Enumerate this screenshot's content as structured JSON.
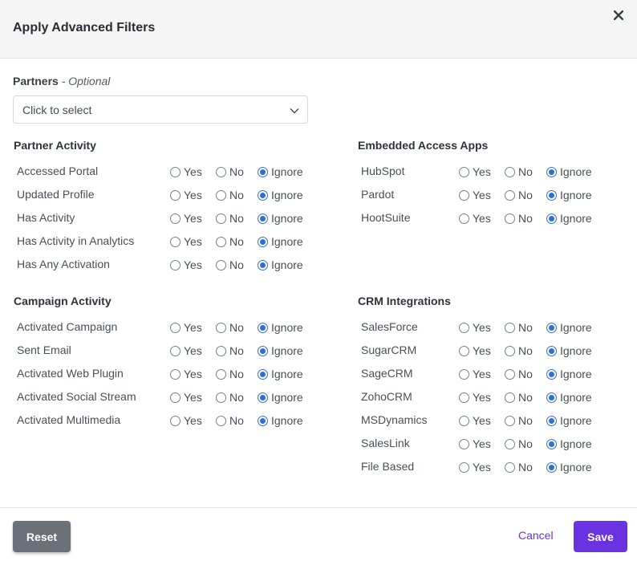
{
  "dialog": {
    "title": "Apply Advanced Filters"
  },
  "partners": {
    "label": "Partners",
    "optional": "- Optional",
    "placeholder": "Click to select"
  },
  "options": {
    "yes": "Yes",
    "no": "No",
    "ignore": "Ignore"
  },
  "sections": {
    "partner_activity": {
      "title": "Partner Activity",
      "rows": [
        {
          "label": "Accessed Portal",
          "selected": "ignore"
        },
        {
          "label": "Updated Profile",
          "selected": "ignore"
        },
        {
          "label": "Has Activity",
          "selected": "ignore"
        },
        {
          "label": "Has Activity in Analytics",
          "selected": "ignore"
        },
        {
          "label": "Has Any Activation",
          "selected": "ignore"
        }
      ]
    },
    "embedded_access_apps": {
      "title": "Embedded Access Apps",
      "rows": [
        {
          "label": "HubSpot",
          "selected": "ignore"
        },
        {
          "label": "Pardot",
          "selected": "ignore"
        },
        {
          "label": "HootSuite",
          "selected": "ignore"
        }
      ]
    },
    "campaign_activity": {
      "title": "Campaign Activity",
      "rows": [
        {
          "label": "Activated Campaign",
          "selected": "ignore"
        },
        {
          "label": "Sent Email",
          "selected": "ignore"
        },
        {
          "label": "Activated Web Plugin",
          "selected": "ignore"
        },
        {
          "label": "Activated Social Stream",
          "selected": "ignore"
        },
        {
          "label": "Activated Multimedia",
          "selected": "ignore"
        }
      ]
    },
    "crm_integrations": {
      "title": "CRM Integrations",
      "rows": [
        {
          "label": "SalesForce",
          "selected": "ignore"
        },
        {
          "label": "SugarCRM",
          "selected": "ignore"
        },
        {
          "label": "SageCRM",
          "selected": "ignore"
        },
        {
          "label": "ZohoCRM",
          "selected": "ignore"
        },
        {
          "label": "MSDynamics",
          "selected": "ignore"
        },
        {
          "label": "SalesLink",
          "selected": "ignore"
        },
        {
          "label": "File Based",
          "selected": "ignore"
        }
      ]
    }
  },
  "footer": {
    "reset": "Reset",
    "cancel": "Cancel",
    "save": "Save"
  },
  "colors": {
    "accent": "#6a32e0",
    "radio_checked": "#2f6fd6",
    "reset_bg": "#6b7079"
  }
}
